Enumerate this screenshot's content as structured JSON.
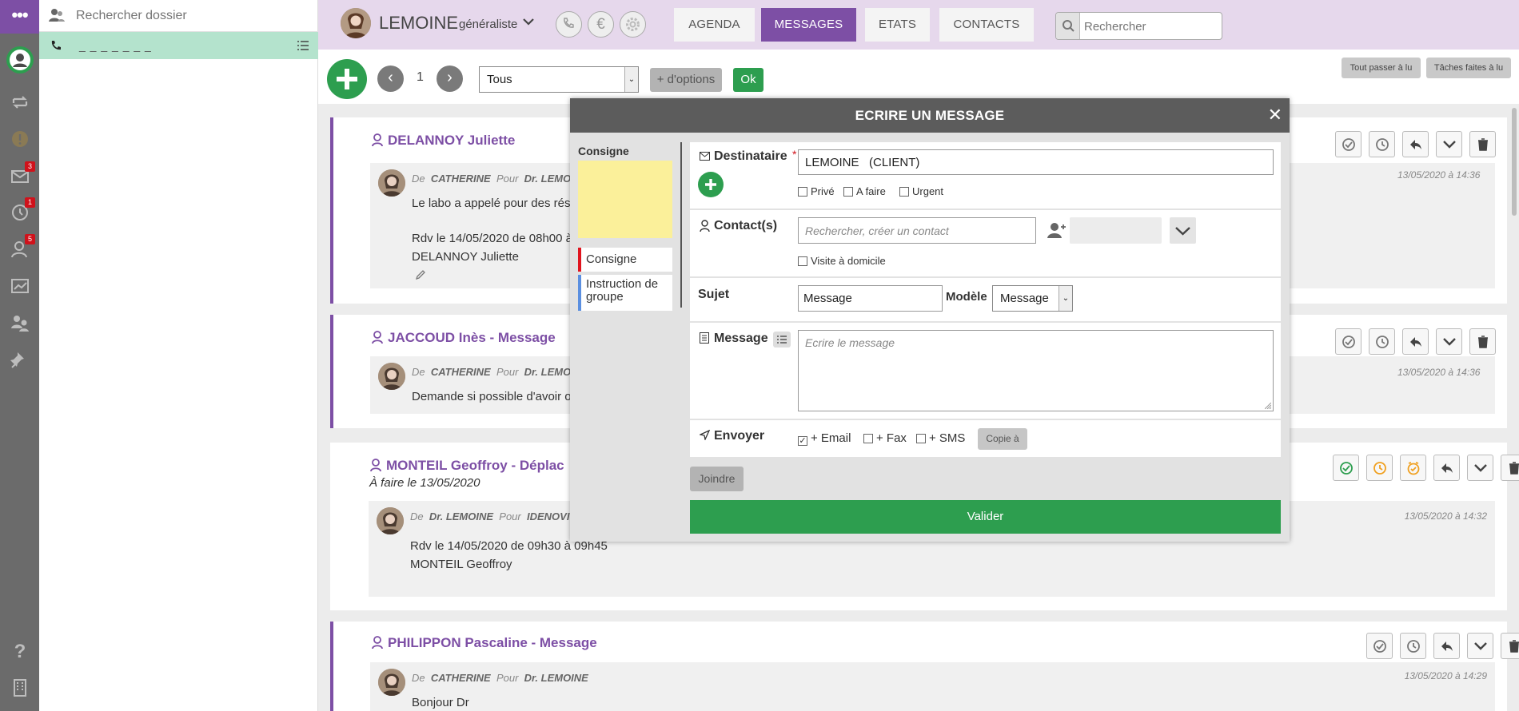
{
  "sidebar": {
    "badges": {
      "mail": "3",
      "history": "1",
      "users": "5"
    }
  },
  "dossier": {
    "search_placeholder": "Rechercher dossier",
    "phone_entry": "_ _ _ _ _ _ _"
  },
  "header": {
    "doctor_name": "LEMOINE",
    "doctor_role": "généraliste",
    "tabs": [
      {
        "label": "AGENDA",
        "active": false
      },
      {
        "label": "MESSAGES",
        "active": true
      },
      {
        "label": "ETATS",
        "active": false
      },
      {
        "label": "CONTACTS",
        "active": false
      }
    ],
    "search_placeholder": "Rechercher"
  },
  "toolbar": {
    "page": "1",
    "filter_value": "Tous",
    "more_options": "+ d'options",
    "ok": "Ok",
    "mark_all_read": "Tout passer à lu",
    "tasks_done": "Tâches faites à lu"
  },
  "messages": [
    {
      "title": "DELANNOY Juliette",
      "from_label": "De",
      "from": "CATHERINE",
      "to_label": "Pour",
      "to": "Dr. LEMO",
      "timestamp": "13/05/2020 à 14:36",
      "lines": [
        "Le labo a appelé pour des résu",
        "",
        "Rdv le 14/05/2020 de 08h00 à",
        "DELANNOY Juliette"
      ]
    },
    {
      "title": "JACCOUD Inès -  Message",
      "from_label": "De",
      "from": "CATHERINE",
      "to_label": "Pour",
      "to": "Dr. LEMO",
      "timestamp": "13/05/2020 à 14:36",
      "lines": [
        "Demande si possible d'avoir o"
      ]
    },
    {
      "title": "MONTEIL Geoffroy -  Déplac",
      "subtitle": "À faire le 13/05/2020",
      "from_label": "De",
      "from": "Dr. LEMOINE",
      "to_label": "Pour",
      "to": "IDENOVI",
      "timestamp": "13/05/2020 à 14:32",
      "lines": [
        "Rdv le 14/05/2020 de 09h30 à 09h45",
        "MONTEIL Geoffroy"
      ]
    },
    {
      "title": "PHILIPPON Pascaline -  Message",
      "from_label": "De",
      "from": "CATHERINE",
      "to_label": "Pour",
      "to": "Dr. LEMOINE",
      "timestamp": "13/05/2020 à 14:29",
      "lines": [
        "Bonjour Dr"
      ]
    }
  ],
  "modal": {
    "title": "ECRIRE UN MESSAGE",
    "consigne_heading": "Consigne",
    "categories": [
      {
        "label": "Consigne",
        "color": "#e0141e"
      },
      {
        "label": "Instruction de groupe",
        "color": "#5b8fe0"
      }
    ],
    "destinataire_label": "Destinataire",
    "required_mark": "*",
    "destinataire_value": "LEMOINE   (CLIENT)",
    "flags": [
      {
        "label": "Privé",
        "checked": false
      },
      {
        "label": "A faire",
        "checked": false
      },
      {
        "label": "Urgent",
        "checked": false
      }
    ],
    "contacts_label": "Contact(s)",
    "contacts_placeholder": "Rechercher, créer un contact",
    "visite_label": "Visite à domicile",
    "sujet_label": "Sujet",
    "sujet_value": "Message",
    "modele_label": "Modèle",
    "modele_value": "Message",
    "message_label": "Message",
    "message_placeholder": "Ecrire le message",
    "envoyer_label": "Envoyer",
    "channels": [
      {
        "label": "+ Email",
        "checked": true
      },
      {
        "label": "+ Fax",
        "checked": false
      },
      {
        "label": "+ SMS",
        "checked": false
      }
    ],
    "copie_label": "Copie à",
    "joindre_label": "Joindre",
    "valider_label": "Valider"
  },
  "colors": {
    "brand": "#7d4fa5",
    "accent_green": "#2d9e4f",
    "sidebar_bg": "#6b6b6b",
    "note_yellow": "#fbf09a"
  }
}
